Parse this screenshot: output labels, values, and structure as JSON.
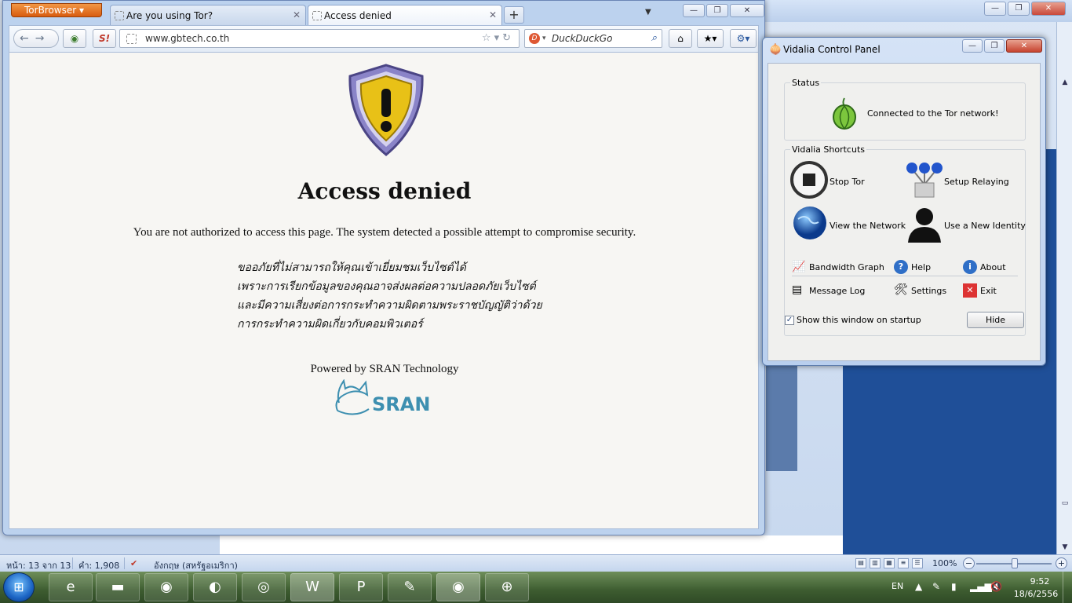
{
  "browser": {
    "menu_label": "TorBrowser",
    "tabs": [
      {
        "label": "Are you using Tor?"
      },
      {
        "label": "Access denied"
      }
    ],
    "new_tab_glyph": "+",
    "url": "www.gbtech.co.th",
    "search_placeholder": "DuckDuckGo",
    "noscript_label": "S!"
  },
  "page": {
    "heading": "Access denied",
    "message": "You are not authorized to access this page. The system detected a possible attempt to compromise security.",
    "thai_lines": [
      "ขออภัยที่ไม่สามารถให้คุณเข้าเยี่ยมชมเว็บไซต์ได้",
      "เพราะการเรียกข้อมูลของคุณอาจส่งผลต่อความปลอดภัยเว็บไซต์",
      "และมีความเสี่ยงต่อการกระทำความผิดตามพระราชบัญญัติว่าด้วย",
      "การกระทำความผิดเกี่ยวกับคอมพิวเตอร์"
    ],
    "powered_by": "Powered by SRAN Technology",
    "logo_text": "SRAN"
  },
  "vidalia": {
    "title": "Vidalia Control Panel",
    "status_group": "Status",
    "status_text": "Connected to the Tor network!",
    "shortcuts_group": "Vidalia Shortcuts",
    "shortcuts": {
      "stop_tor": "Stop Tor",
      "setup_relaying": "Setup Relaying",
      "view_network": "View the Network",
      "new_identity": "Use a New Identity"
    },
    "tools": {
      "bandwidth": "Bandwidth Graph",
      "help": "Help",
      "about": "About",
      "message_log": "Message Log",
      "settings": "Settings",
      "exit": "Exit"
    },
    "startup_label": "Show this window on startup",
    "hide_label": "Hide"
  },
  "word": {
    "status_page": "หน้า: 13 จาก 13",
    "status_words": "คำ: 1,908",
    "status_lang": "อังกฤษ (สหรัฐอเมริกา)",
    "zoom": "100%"
  },
  "taskbar": {
    "lang": "EN",
    "time": "9:52",
    "date": "18/6/2556"
  },
  "colors": {
    "tor_orange": "#e1721f",
    "shield_yellow": "#e8c117",
    "taskbar_green": "#4a6b3a"
  }
}
